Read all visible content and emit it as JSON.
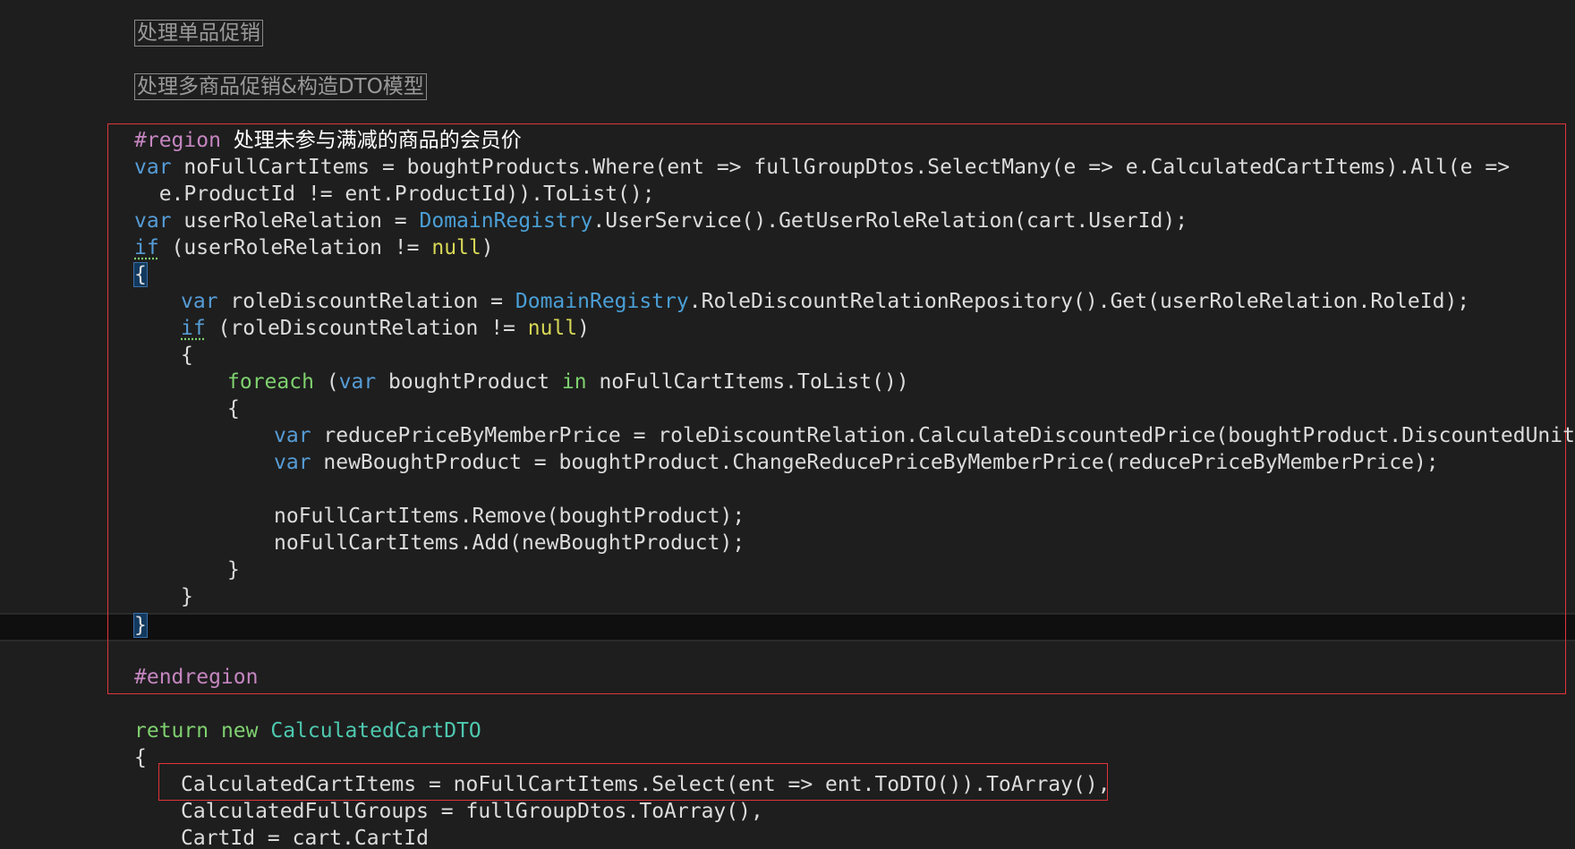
{
  "collapsed_regions": [
    "处理单品促销",
    "处理多商品促销&构造DTO模型"
  ],
  "region": {
    "start_directive": "#region",
    "title": "处理未参与满减的商品的会员价",
    "end_directive": "#endregion"
  },
  "code": {
    "l1_a": "var",
    "l1_b": " noFullCartItems = boughtProducts.Where(ent => fullGroupDtos.SelectMany(e => e.CalculatedCartItems).All(e =>",
    "l2": "  e.ProductId != ent.ProductId)).ToList();",
    "l3_a": "var",
    "l3_b": " userRoleRelation = ",
    "l3_c": "DomainRegistry",
    "l3_d": ".UserService().GetUserRoleRelation(cart.UserId);",
    "l4_a": "if",
    "l4_b": " (userRoleRelation != ",
    "l4_c": "null",
    "l4_d": ")",
    "l5": "{",
    "l6_a": "var",
    "l6_b": " roleDiscountRelation = ",
    "l6_c": "DomainRegistry",
    "l6_d": ".RoleDiscountRelationRepository().Get(userRoleRelation.RoleId);",
    "l7_a": "if",
    "l7_b": " (roleDiscountRelation != ",
    "l7_c": "null",
    "l7_d": ")",
    "l8": "{",
    "l9_a": "foreach",
    "l9_b": " (",
    "l9_c": "var",
    "l9_d": " boughtProduct ",
    "l9_e": "in",
    "l9_f": " noFullCartItems.ToList())",
    "l10": "{",
    "l11_a": "var",
    "l11_b": " reducePriceByMemberPrice = roleDiscountRelation.CalculateDiscountedPrice(boughtProduct.DiscountedUnitPrice);",
    "l12_a": "var",
    "l12_b": " newBoughtProduct = boughtProduct.ChangeReducePriceByMemberPrice(reducePriceByMemberPrice);",
    "l13": "noFullCartItems.Remove(boughtProduct);",
    "l14": "noFullCartItems.Add(newBoughtProduct);",
    "l15": "}",
    "l16": "}",
    "l17": "}",
    "r1_a": "return",
    "r1_b": " ",
    "r1_c": "new",
    "r1_d": " ",
    "r1_e": "CalculatedCartDTO",
    "r2": "{",
    "r3": "CalculatedCartItems = noFullCartItems.Select(ent => ent.ToDTO()).ToArray(),",
    "r4": "CalculatedFullGroups = fullGroupDtos.ToArray(),",
    "r5": "CartId = cart.CartId"
  },
  "colors": {
    "background": "#1e1e1e",
    "highlight_box": "#e0353b"
  }
}
